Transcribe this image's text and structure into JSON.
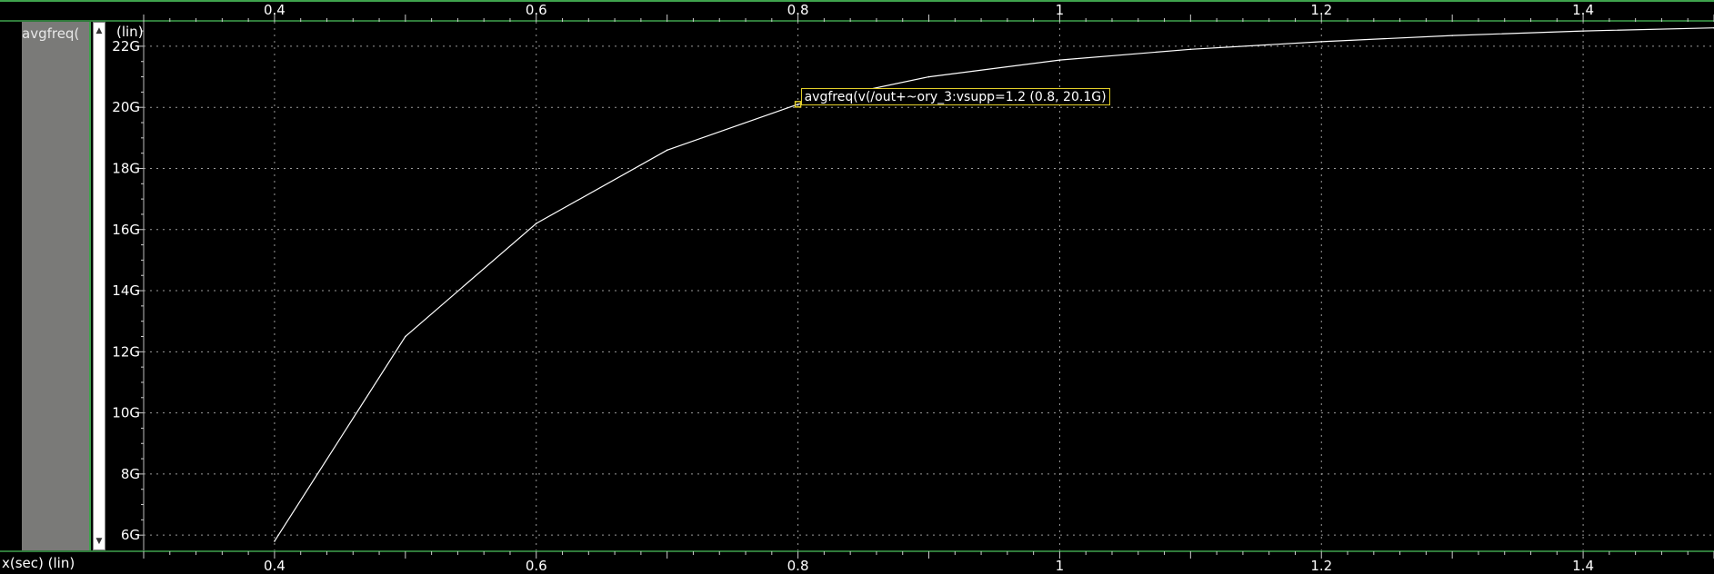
{
  "panel": {
    "trace_label": "avgfreq(",
    "y_scale_label": "(lin)",
    "x_axis_label": "x(sec) (lin)"
  },
  "colors": {
    "background": "#000000",
    "trace": "#ffffff",
    "grid": "#9a9a9a",
    "marker_border": "#e3cf2a",
    "frame_accent": "#3fa34d",
    "trace_panel": "#7a7a78"
  },
  "icons": {
    "scroll_up": "triangle-up-icon",
    "scroll_down": "triangle-down-icon"
  },
  "chart_data": {
    "type": "line",
    "series": [
      {
        "x": [
          0.4,
          0.5,
          0.6,
          0.7,
          0.8,
          0.9,
          1.0,
          1.1,
          1.2,
          1.3,
          1.4,
          1.5
        ],
        "y": [
          5.8,
          12.5,
          16.2,
          18.6,
          20.1,
          21.0,
          21.55,
          21.9,
          22.15,
          22.35,
          22.5,
          22.6
        ]
      }
    ],
    "xlim": [
      0.3,
      1.5
    ],
    "ylim": [
      5.5,
      22.8
    ],
    "x_ticks": [
      0.4,
      0.6,
      0.8,
      1,
      1.2,
      1.4
    ],
    "x_tick_labels": [
      "0.4",
      "0.6",
      "0.8",
      "1",
      "1.2",
      "1.4"
    ],
    "y_ticks": [
      6,
      8,
      10,
      12,
      14,
      16,
      18,
      20,
      22
    ],
    "y_tick_labels": [
      "6G",
      "8G",
      "10G",
      "12G",
      "14G",
      "16G",
      "18G",
      "20G",
      "22G"
    ],
    "grid": true,
    "marker": {
      "x": 0.8,
      "y": 20.1,
      "label": "avgfreq(v(/out+~ory_3:vsupp=1.2 (0.8, 20.1G)"
    }
  }
}
